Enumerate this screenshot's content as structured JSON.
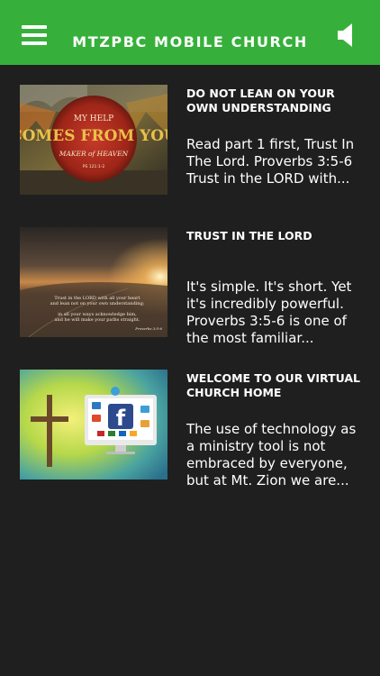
{
  "app": {
    "title": "MTZPBC MOBILE CHURCH",
    "accent_color": "#36b03a",
    "menu_icon": "hamburger-menu-icon",
    "sound_icon": "speaker-icon"
  },
  "posts": [
    {
      "title": "DO NOT LEAN ON YOUR OWN UNDERSTANDING",
      "excerpt": "Read part 1 first, Trust In The Lord. Proverbs 3:5-6 Trust in the LORD with...",
      "thumbnail": {
        "line1": "MY HELP",
        "line2": "COMES FROM YOU",
        "line3": "MAKER of HEAVEN",
        "line4": "PS 121:1-2"
      }
    },
    {
      "title": "TRUST IN THE LORD",
      "excerpt": "It's simple. It's short. Yet it's incredibly powerful. Proverbs 3:5-6 is one of the most familiar...",
      "thumbnail": {
        "verse1": "Trust in the LORD with all your heart",
        "verse2": "and lean not on your own understanding;",
        "verse3": "in all your ways acknowledge him,",
        "verse4": "and he will make your paths straight.",
        "ref": "Proverbs 3:5-6"
      }
    },
    {
      "title": "WELCOME TO OUR VIRTUAL CHURCH HOME",
      "excerpt": "The use of technology as a ministry tool is not embraced by everyone, but at Mt. Zion we are...",
      "thumbnail": {
        "brand": "f"
      }
    }
  ]
}
